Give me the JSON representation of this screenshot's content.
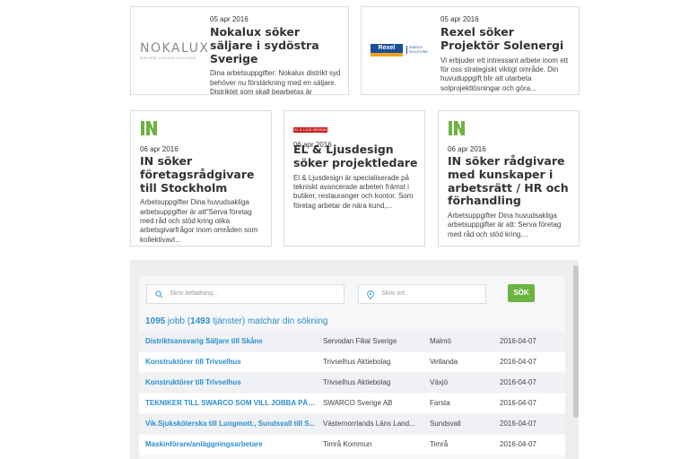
{
  "top_cards": [
    {
      "logo": "nokalux-logo",
      "logo_word": "NOKALUX",
      "logo_sub": "EFFICIENT LIGHTING SOLUTIONS",
      "date": "05 apr 2016",
      "title": "Nokalux söker säljare i sydöstra Sverige",
      "desc": "Dina arbetsuppgifter: Nokalux distrikt syd behöver nu förstärkning med en säljare. Distriktet som skall bearbetas är framförallt Småland och..."
    },
    {
      "logo": "rexel-logo",
      "logo_word": "Rexel",
      "logo_sub": "ENERGY SOLUTIONS",
      "date": "05 apr 2016",
      "title": "Rexel söker Projektör Solenergi",
      "desc": "Vi erbjuder ett intressant arbete inom ett för oss strategiskt viktigt område. Din huvuduppgift blir att utarbeta solprojektlösningar och göra..."
    }
  ],
  "mid_cards": [
    {
      "logo": "in-logo",
      "date": "06 apr 2016",
      "title": "IN söker företagsrådgivare till Stockholm",
      "desc": "Arbetsuppgifter Dina huvudsakliga arbetsuppgifter är att\"Serva företag med råd och stöd kring olika arbetsgivarfrågor inom områden som kollektivavt..."
    },
    {
      "logo": "el-ljusdesign-logo",
      "logo_word": "EL & LJUS DESIGN",
      "date": "06 apr 2016",
      "title": "EL & Ljusdesign söker projektledare",
      "desc": "El & Ljusdesign är specialiserade på tekniskt avancerade arbeten främst i butiker, restauranger och kontor. Som företag arbetar de nära kund,..."
    },
    {
      "logo": "in-logo",
      "date": "06 apr 2016",
      "title": "IN söker rådgivare med kunskaper i arbetsrätt / HR och förhandling",
      "desc": "Arbetsuppgifter Dina huvudsakliga arbetsuppgifter är att: Serva företag med råd och stöd kring...."
    }
  ],
  "search": {
    "job_placeholder": "Skriv befattning...",
    "location_placeholder": "Skriv ort...",
    "button_label": "SÖK",
    "jobs_count": "1095",
    "jobs_word": "jobb (",
    "services_count": "1493",
    "suffix": " tjänster) matchar din sökning"
  },
  "results": [
    {
      "title": "Distriktsansvarig Säljare till Skåne",
      "company": "Servodan Filial Sverige",
      "location": "Malmö",
      "date": "2016-04-07"
    },
    {
      "title": "Konstruktörer till Trivselhus",
      "company": "Trivselhus Aktiebolag",
      "location": "Vetlanda",
      "date": "2016-04-07"
    },
    {
      "title": "Konstruktörer till Trivselhus",
      "company": "Trivselhus Aktiebolag",
      "location": "Växjö",
      "date": "2016-04-07"
    },
    {
      "title": "TEKNIKER TILL SWARCO SOM VILL JOBBA PÅ F...",
      "company": "SWARCO Sverige AB",
      "location": "Farsta",
      "date": "2016-04-07"
    },
    {
      "title": "Vik.Sjuksköterska till Lungmott., Sundsvall till S...",
      "company": "Västernorrlands Läns Land...",
      "location": "Sundsvall",
      "date": "2016-04-07"
    },
    {
      "title": "Maskinförare/anläggningsarbetare",
      "company": "Timrå Kommun",
      "location": "Timrå",
      "date": "2016-04-07"
    }
  ],
  "colors": {
    "link": "#2a8fcf",
    "button": "#6cb33f",
    "in_green": "#6cb33f"
  }
}
